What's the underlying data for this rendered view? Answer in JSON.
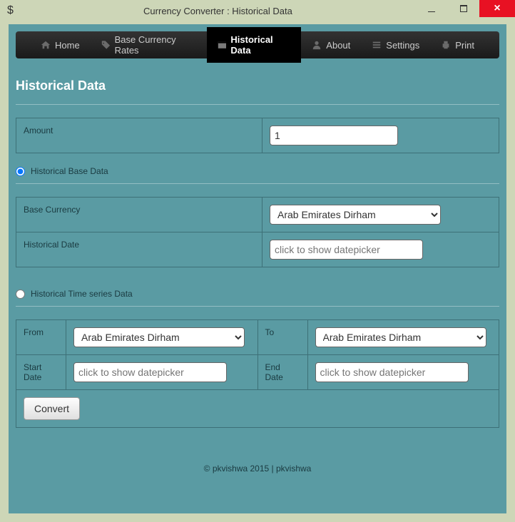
{
  "window": {
    "title": "Currency Converter : Historical Data",
    "icon": "$"
  },
  "menu": {
    "home": "Home",
    "base_rates": "Base Currency Rates",
    "historical": "Historical Data",
    "about": "About",
    "settings": "Settings",
    "print": "Print"
  },
  "page": {
    "title": "Historical Data"
  },
  "form": {
    "amount_label": "Amount",
    "amount_value": "1",
    "radio_base": "Historical Base Data",
    "radio_series": "Historical Time series Data",
    "base_currency_label": "Base Currency",
    "base_currency_value": "Arab Emirates Dirham",
    "historical_date_label": "Historical Date",
    "date_placeholder": "click to show datepicker",
    "from_label": "From",
    "from_value": "Arab Emirates Dirham",
    "to_label": "To",
    "to_value": "Arab Emirates Dirham",
    "start_date_label": "Start Date",
    "end_date_label": "End Date",
    "convert_button": "Convert"
  },
  "footer": {
    "text": "© pkvishwa 2015 | pkvishwa"
  }
}
